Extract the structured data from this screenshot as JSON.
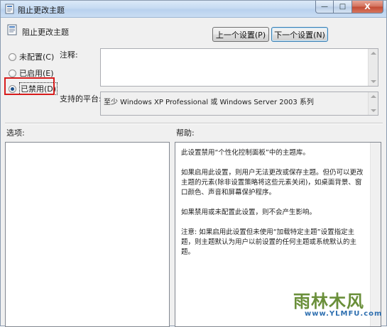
{
  "window": {
    "title": "阻止更改主题",
    "controls": {
      "minimize": "—",
      "maximize": "□",
      "close": "X"
    }
  },
  "header": {
    "policy_title": "阻止更改主题",
    "prev_button": "上一个设置(P)",
    "next_button": "下一个设置(N)"
  },
  "state": {
    "options": [
      {
        "label": "未配置(C)",
        "checked": false
      },
      {
        "label": "已启用(E)",
        "checked": false
      },
      {
        "label": "已禁用(D)",
        "checked": true
      }
    ]
  },
  "labels": {
    "comment": "注释:",
    "supported": "支持的平台:",
    "options": "选项:",
    "help": "帮助:"
  },
  "supported_value": "至少 Windows XP Professional 或 Windows Server 2003 系列",
  "help_text": [
    "此设置禁用“个性化控制面板”中的主题库。",
    "如果启用此设置，则用户无法更改或保存主题。但仍可以更改主题的元素(除非设置策略将这些元素关闭)，如桌面背景、窗口颜色、声音和屏幕保护程序。",
    "如果禁用或未配置此设置，则不会产生影响。",
    "注意: 如果启用此设置但未使用“加载特定主题”设置指定主题，则主题默认为用户以前设置的任何主题或系统默认的主题。"
  ],
  "watermark": {
    "brand": "雨林木风",
    "url": "www.YLMFU.com"
  },
  "colors": {
    "highlight_border": "#d81d1d",
    "dialog_bg": "#f0f0f0",
    "titlebar": "#c6dbf2"
  },
  "icons": [
    "policy-doc-icon",
    "minimize-icon",
    "maximize-icon",
    "close-icon"
  ]
}
